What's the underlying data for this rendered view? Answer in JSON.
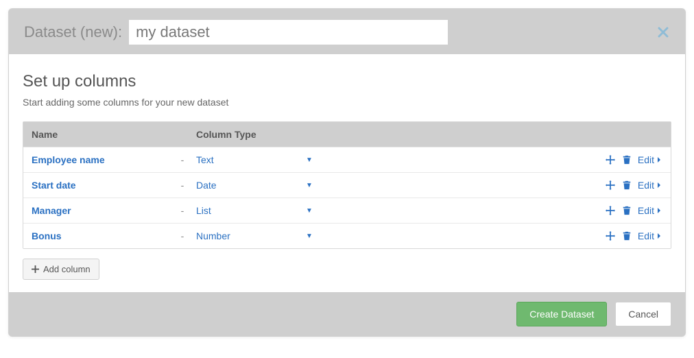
{
  "header": {
    "label": "Dataset (new):",
    "dataset_name": "my dataset"
  },
  "section": {
    "title": "Set up columns",
    "subtitle": "Start adding some columns for your new dataset"
  },
  "table": {
    "head_name": "Name",
    "head_type": "Column Type",
    "rows": [
      {
        "name": "Employee name",
        "dash": "-",
        "type": "Text",
        "edit": "Edit"
      },
      {
        "name": "Start date",
        "dash": "-",
        "type": "Date",
        "edit": "Edit"
      },
      {
        "name": "Manager",
        "dash": "-",
        "type": "List",
        "edit": "Edit"
      },
      {
        "name": "Bonus",
        "dash": "-",
        "type": "Number",
        "edit": "Edit"
      }
    ]
  },
  "buttons": {
    "add_column": "Add column",
    "create": "Create Dataset",
    "cancel": "Cancel"
  }
}
